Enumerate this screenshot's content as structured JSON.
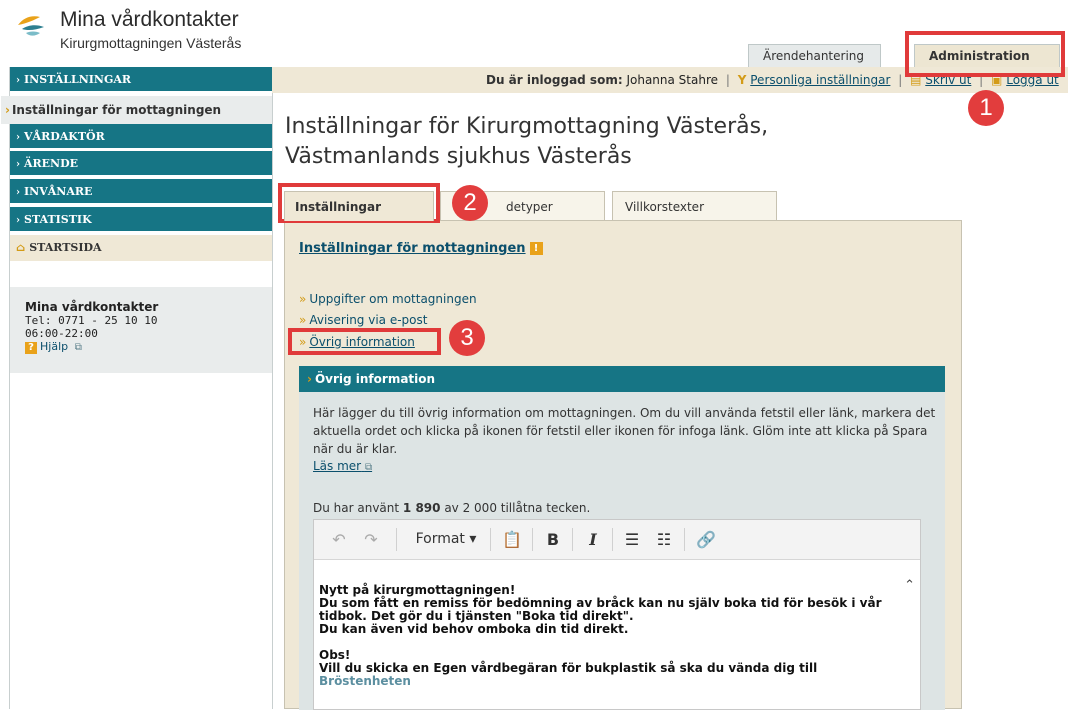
{
  "header": {
    "app_name": "Mina vårdkontakter",
    "unit_name": "Kirurgmottagningen Västerås",
    "tabs": [
      {
        "label": "Ärendehantering"
      },
      {
        "label": "Administration"
      }
    ]
  },
  "callouts": [
    "1",
    "2",
    "3"
  ],
  "sidebar": {
    "items": [
      {
        "label": "INSTÄLLNINGAR"
      },
      {
        "label": "Inställningar för mottagningen"
      },
      {
        "label": "VÅRDAKTÖR"
      },
      {
        "label": "ÄRENDE"
      },
      {
        "label": "INVÅNARE"
      },
      {
        "label": "STATISTIK"
      },
      {
        "label": "STARTSIDA"
      }
    ],
    "contact": {
      "name": "Mina vårdkontakter",
      "phone": "Tel: 0771 - 25 10 10",
      "hours": "06:00-22:00",
      "help_label": "Hjälp"
    }
  },
  "loginbar": {
    "logged_in_label": "Du är inloggad som:",
    "user": "Johanna Stahre",
    "personal_settings": "Personliga inställningar",
    "print": "Skriv ut",
    "logout": "Logga ut"
  },
  "main": {
    "title": "Inställningar för Kirurgmottagning Västerås, Västmanlands sjukhus Västerås",
    "tabs": [
      {
        "label": "Inställningar"
      },
      {
        "label": "detyper"
      },
      {
        "label": "Villkorstexter"
      }
    ],
    "section_title": "Inställningar för mottagningen",
    "links": [
      {
        "label": "Uppgifter om mottagningen"
      },
      {
        "label": "Avisering via e-post"
      },
      {
        "label": "Övrig information"
      }
    ],
    "panel": {
      "title": "Övrig information",
      "description": "Här lägger du till övrig information om mottagningen. Om du vill använda fetstil eller länk, markera det aktuella ordet och klicka på ikonen för fetstil eller ikonen för infoga länk. Glöm inte att klicka på Spara när du är klar.",
      "read_more": "Läs mer",
      "count_prefix": "Du har använt",
      "count_used": "1 890",
      "count_suffix": "av 2 000 tillåtna tecken.",
      "toolbar": {
        "format_label": "Format",
        "bold": "B",
        "italic": "I"
      },
      "editor_lines": [
        "Nytt på kirurgmottagningen!",
        "Du som fått en remiss för bedömning av bråck kan nu själv boka tid för besök i vår tidbok. Det gör du i tjänsten \"Boka tid direkt\".",
        "Du kan även vid behov omboka din tid direkt.",
        "Obs!",
        "Vill du skicka en Egen vårdbegäran för bukplastik så ska du vända dig till",
        "Bröstenheten"
      ]
    }
  },
  "colors": {
    "nav_teal": "#167585",
    "beige": "#efe8d6",
    "accent_orange": "#d39b17",
    "callout_red": "#e23d3d"
  }
}
